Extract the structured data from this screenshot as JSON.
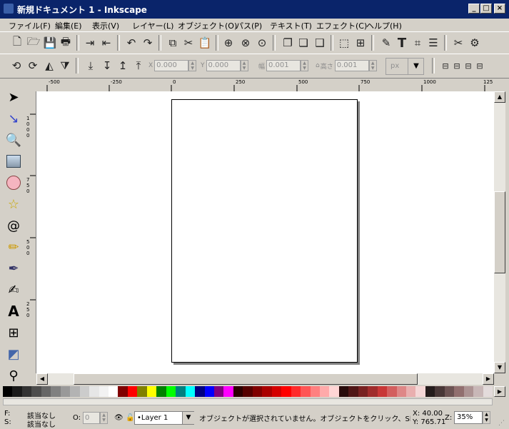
{
  "window": {
    "title": "新規ドキュメント 1 - Inkscape",
    "minimize": "_",
    "maximize": "□",
    "close": "×"
  },
  "menubar": [
    "ファイル(F)",
    "編集(E)",
    "表示(V)",
    "レイヤー(L)",
    "オブジェクト(O)",
    "パス(P)",
    "テキスト(T)",
    "エフェクト(C)",
    "ヘルプ(H)"
  ],
  "toolcontrols": {
    "x_label": "X",
    "x_value": "0.000",
    "y_label": "Y",
    "y_value": "0.000",
    "w_label": "幅",
    "w_value": "0.001",
    "h_label": "高さ",
    "h_value": "0.001",
    "unit": "px"
  },
  "ruler": {
    "h_ticks": [
      "-500",
      "-250",
      "0",
      "250",
      "500",
      "750",
      "1000",
      "125"
    ],
    "v_labels": [
      "1000",
      "750",
      "500",
      "250"
    ]
  },
  "palette": [
    "#000000",
    "#1a1a1a",
    "#333333",
    "#4d4d4d",
    "#666666",
    "#808080",
    "#999999",
    "#b3b3b3",
    "#cccccc",
    "#e6e6e6",
    "#f2f2f2",
    "#ffffff",
    "#800000",
    "#ff0000",
    "#808000",
    "#ffff00",
    "#008000",
    "#00ff00",
    "#008080",
    "#00ffff",
    "#000080",
    "#0000ff",
    "#800080",
    "#ff00ff",
    "#2b0000",
    "#550000",
    "#800000",
    "#aa0000",
    "#d40000",
    "#ff0000",
    "#ff2a2a",
    "#ff5555",
    "#ff8080",
    "#ffaaaa",
    "#ffd5d5",
    "#280b0b",
    "#501616",
    "#782121",
    "#a02c2c",
    "#c83737",
    "#d35f5f",
    "#de8787",
    "#e9afaf",
    "#f4d7d7",
    "#241c1c",
    "#483737",
    "#6c5353",
    "#916f6f",
    "#ac9393",
    "#c8b7b7",
    "#e3dbdb"
  ],
  "status": {
    "fill_label": "F:",
    "stroke_label": "S:",
    "fill_value": "該当なし",
    "stroke_value": "該当なし",
    "opacity_label": "O:",
    "opacity_value": "0",
    "layer": "•Layer 1",
    "message": "オブジェクトが選択されていません。オブジェクトをクリック、Shift+ク",
    "x_coord": "X: 40.00",
    "y_coord": "Y: 765.71",
    "zoom_label": "Z:",
    "zoom_value": "35%"
  }
}
